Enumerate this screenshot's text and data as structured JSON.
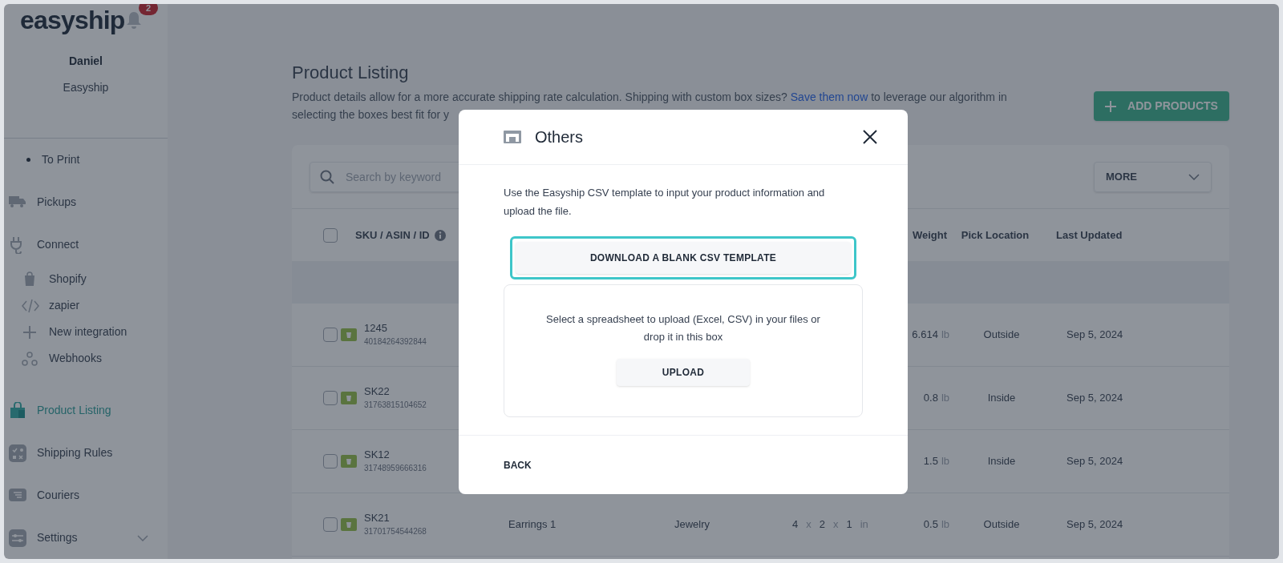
{
  "sidebar": {
    "logo": "easyship",
    "notifications": "2",
    "user": {
      "name": "Daniel",
      "company": "Easyship"
    },
    "items": [
      {
        "label": "To Print",
        "kind": "bullet",
        "selected": false
      },
      {
        "label": "Pickups",
        "kind": "section",
        "selected": false
      },
      {
        "label": "Connect",
        "kind": "section",
        "selected": false
      },
      {
        "label": "Shopify",
        "kind": "sub",
        "selected": false
      },
      {
        "label": "zapier",
        "kind": "sub",
        "selected": false
      },
      {
        "label": "New integration",
        "kind": "sub",
        "selected": false
      },
      {
        "label": "Webhooks",
        "kind": "sub",
        "selected": false
      },
      {
        "label": "Product Listing",
        "kind": "section",
        "selected": true
      },
      {
        "label": "Shipping Rules",
        "kind": "section",
        "selected": false
      },
      {
        "label": "Couriers",
        "kind": "section",
        "selected": false
      },
      {
        "label": "Settings",
        "kind": "group",
        "selected": false
      }
    ]
  },
  "page": {
    "title": "Product Listing",
    "description": "Product details allow for a more accurate shipping rate calculation. Shipping with custom box sizes? ",
    "link": "Save them now",
    "description_end": " to leverage our algorithm in selecting the boxes best fit for y",
    "add_button": "ADD PRODUCTS"
  },
  "table": {
    "select_all_checked": false,
    "search": {
      "placeholder": "Search by keyword"
    },
    "more": "MORE",
    "columns": [
      {
        "label": "SKU / ASIN / ID"
      },
      {
        "label": "Weight"
      },
      {
        "label": "Pick Location"
      },
      {
        "label": "Last Updated"
      }
    ],
    "rows": [
      {
        "checked": false,
        "sku": "1245",
        "id": "40184264392844",
        "weight": "6.614",
        "unit": "lb",
        "location": "Outside",
        "updated": "Sep 5, 2024"
      },
      {
        "checked": false,
        "sku": "SK22",
        "id": "31763815104652",
        "weight": "0.8",
        "unit": "lb",
        "location": "Inside",
        "updated": "Sep 5, 2024"
      },
      {
        "checked": false,
        "sku": "SK12",
        "id": "31748959666316",
        "weight": "1.5",
        "unit": "lb",
        "location": "Inside",
        "updated": "Sep 5, 2024"
      },
      {
        "checked": false,
        "sku": "SK21",
        "id": "31701754544268",
        "name": "Earrings 1",
        "category": "Jewelry",
        "dims": [
          "4",
          "x",
          "2",
          "x",
          "1",
          "in"
        ],
        "weight": "0.5",
        "unit": "lb",
        "location": "Outside",
        "updated": "Sep 5, 2024"
      }
    ]
  },
  "modal": {
    "title": "Others",
    "description": "Use the Easyship CSV template to input your product information and upload the file.",
    "download_button": "DOWNLOAD A BLANK CSV TEMPLATE",
    "download_highlighted": true,
    "upload_text": "Select a spreadsheet to upload (Excel, CSV) in your files or drop it in this box",
    "upload_button": "UPLOAD",
    "back_button": "BACK"
  }
}
